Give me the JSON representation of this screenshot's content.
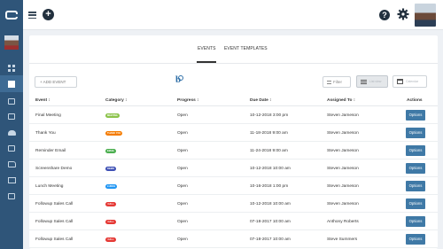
{
  "top_bar": {
    "add_symbol": "+",
    "help_symbol": "?"
  },
  "tabs": [
    {
      "label": "EVENTS",
      "active": true
    },
    {
      "label": "EVENT TEMPLATES",
      "active": false
    }
  ],
  "toolbar": {
    "add_event_label": "+ ADD EVENT",
    "brand_letter": "b",
    "filter_label": "Filter",
    "view_list_label": "List view",
    "view_calendar_label": "Calendar"
  },
  "table": {
    "columns": [
      "Event ↕",
      "Category ↕",
      "Progress ↕",
      "Due Date ↕",
      "Assigned To ↕",
      "Actions"
    ],
    "rows": [
      {
        "event": "Final Meeting",
        "category": "MEETING",
        "category_color": "#8bc34a",
        "progress": "Open",
        "due": "10-12-2018 3:00 pm",
        "assigned": "Steven Jameson",
        "action": "Options"
      },
      {
        "event": "Thank You",
        "category": "THANK YOU",
        "category_color": "#f57c00",
        "progress": "Open",
        "due": "11-18-2018 9:00 am",
        "assigned": "Steven Jameson",
        "action": "Options"
      },
      {
        "event": "Reminder Email",
        "category": "EMAIL",
        "category_color": "#4caf50",
        "progress": "Open",
        "due": "11-24-2018 9:00 am",
        "assigned": "Steven Jameson",
        "action": "Options"
      },
      {
        "event": "Screenshare Demo",
        "category": "DEMO",
        "category_color": "#3f51b5",
        "progress": "Open",
        "due": "10-12-2018 10:00 am",
        "assigned": "Steven Jameson",
        "action": "Options"
      },
      {
        "event": "Lunch Meeting",
        "category": "LUNCH",
        "category_color": "#2196f3",
        "progress": "Open",
        "due": "10-16-2018 1:00 pm",
        "assigned": "Steven Jameson",
        "action": "Options"
      },
      {
        "event": "Followup Sales Call",
        "category": "CALL",
        "category_color": "#e53935",
        "progress": "Open",
        "due": "10-12-2018 10:00 am",
        "assigned": "Steven Jameson",
        "action": "Options"
      },
      {
        "event": "Followup Sales Call",
        "category": "CALL",
        "category_color": "#e53935",
        "progress": "Open",
        "due": "07-18-2017 10:00 am",
        "assigned": "Anthony Roberts",
        "action": "Options"
      },
      {
        "event": "Followup Sales Call",
        "category": "CALL",
        "category_color": "#e53935",
        "progress": "Open",
        "due": "07-18-2017 10:00 am",
        "assigned": "Steve Summers",
        "action": "Options"
      }
    ]
  },
  "colors": {
    "sidebar": "#2f5579",
    "options_button": "#3f79a6"
  },
  "icons": [
    "logo-icon",
    "hamburger-icon",
    "add-circle-icon",
    "help-icon",
    "gear-icon",
    "dashboard-icon",
    "calendar-icon",
    "contacts-icon",
    "grid-icon",
    "people-icon",
    "folder-icon",
    "mail-icon",
    "reports-icon"
  ]
}
